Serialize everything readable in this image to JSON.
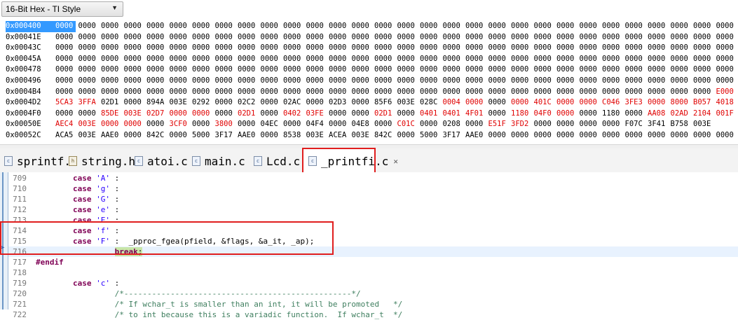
{
  "memory_view": {
    "format_select": "16-Bit Hex - TI Style",
    "rows": [
      {
        "addr": "0x000400",
        "words": [
          "0000",
          "0000",
          "0000",
          "0000",
          "0000",
          "0000",
          "0000",
          "0000",
          "0000",
          "0000",
          "0000",
          "0000",
          "0000",
          "0000",
          "0000",
          "0000",
          "0000",
          "0000",
          "0000",
          "0000",
          "0000",
          "0000",
          "0000",
          "0000",
          "0000",
          "0000",
          "0000",
          "0000",
          "0000",
          "0000"
        ]
      },
      {
        "addr": "0x00041E",
        "words": [
          "0000",
          "0000",
          "0000",
          "0000",
          "0000",
          "0000",
          "0000",
          "0000",
          "0000",
          "0000",
          "0000",
          "0000",
          "0000",
          "0000",
          "0000",
          "0000",
          "0000",
          "0000",
          "0000",
          "0000",
          "0000",
          "0000",
          "0000",
          "0000",
          "0000",
          "0000",
          "0000",
          "0000",
          "0000",
          "0000"
        ]
      },
      {
        "addr": "0x00043C",
        "words": [
          "0000",
          "0000",
          "0000",
          "0000",
          "0000",
          "0000",
          "0000",
          "0000",
          "0000",
          "0000",
          "0000",
          "0000",
          "0000",
          "0000",
          "0000",
          "0000",
          "0000",
          "0000",
          "0000",
          "0000",
          "0000",
          "0000",
          "0000",
          "0000",
          "0000",
          "0000",
          "0000",
          "0000",
          "0000",
          "0000"
        ]
      },
      {
        "addr": "0x00045A",
        "words": [
          "0000",
          "0000",
          "0000",
          "0000",
          "0000",
          "0000",
          "0000",
          "0000",
          "0000",
          "0000",
          "0000",
          "0000",
          "0000",
          "0000",
          "0000",
          "0000",
          "0000",
          "0000",
          "0000",
          "0000",
          "0000",
          "0000",
          "0000",
          "0000",
          "0000",
          "0000",
          "0000",
          "0000",
          "0000",
          "0000"
        ]
      },
      {
        "addr": "0x000478",
        "words": [
          "0000",
          "0000",
          "0000",
          "0000",
          "0000",
          "0000",
          "0000",
          "0000",
          "0000",
          "0000",
          "0000",
          "0000",
          "0000",
          "0000",
          "0000",
          "0000",
          "0000",
          "0000",
          "0000",
          "0000",
          "0000",
          "0000",
          "0000",
          "0000",
          "0000",
          "0000",
          "0000",
          "0000",
          "0000",
          "0000"
        ]
      },
      {
        "addr": "0x000496",
        "words": [
          "0000",
          "0000",
          "0000",
          "0000",
          "0000",
          "0000",
          "0000",
          "0000",
          "0000",
          "0000",
          "0000",
          "0000",
          "0000",
          "0000",
          "0000",
          "0000",
          "0000",
          "0000",
          "0000",
          "0000",
          "0000",
          "0000",
          "0000",
          "0000",
          "0000",
          "0000",
          "0000",
          "0000",
          "0000",
          "0000"
        ]
      },
      {
        "addr": "0x0004B4",
        "words": [
          "0000",
          "0000",
          "0000",
          "0000",
          "0000",
          "0000",
          "0000",
          "0000",
          "0000",
          "0000",
          "0000",
          "0000",
          "0000",
          "0000",
          "0000",
          "0000",
          "0000",
          "0000",
          "0000",
          "0000",
          "0000",
          "0000",
          "0000",
          "0000",
          "0000",
          "0000",
          "0000",
          "0000",
          "0000",
          "E000"
        ],
        "changed": [
          29
        ]
      },
      {
        "addr": "0x0004D2",
        "words": [
          "5CA3",
          "3FFA",
          "02D1",
          "0000",
          "894A",
          "003E",
          "0292",
          "0000",
          "02C2",
          "0000",
          "02AC",
          "0000",
          "02D3",
          "0000",
          "85F6",
          "003E",
          "028C",
          "0004",
          "0000",
          "0000",
          "0000",
          "401C",
          "0000",
          "0000",
          "C046",
          "3FE3",
          "0000",
          "8000",
          "B057",
          "4018"
        ],
        "changed": [
          0,
          1,
          17,
          18,
          20,
          21,
          22,
          23,
          24,
          25,
          26,
          27,
          28,
          29
        ]
      },
      {
        "addr": "0x0004F0",
        "words": [
          "0000",
          "0000",
          "85DE",
          "003E",
          "02D7",
          "0000",
          "0000",
          "0000",
          "02D1",
          "0000",
          "0402",
          "03FE",
          "0000",
          "0000",
          "02D1",
          "0000",
          "0401",
          "0401",
          "4F01",
          "0000",
          "1180",
          "04F0",
          "0000",
          "0000",
          "1180",
          "0000",
          "AA08",
          "02AD",
          "2104",
          "001F"
        ],
        "changed": [
          2,
          3,
          4,
          5,
          6,
          8,
          10,
          11,
          14,
          16,
          17,
          18,
          20,
          21,
          22,
          26,
          27,
          28,
          29
        ]
      },
      {
        "addr": "0x00050E",
        "words": [
          "AEC4",
          "003E",
          "0000",
          "0000",
          "0000",
          "3CF0",
          "0000",
          "3800",
          "0000",
          "04EC",
          "0000",
          "04F4",
          "0000",
          "04E8",
          "0000",
          "C01C",
          "0000",
          "0208",
          "0000",
          "E51F",
          "3FD2",
          "0000",
          "0000",
          "0000",
          "0000",
          "F07C",
          "3F41",
          "B758",
          "003E"
        ],
        "changed": [
          0,
          1,
          2,
          3,
          5,
          7,
          15,
          19,
          20
        ]
      },
      {
        "addr": "0x00052C",
        "words": [
          "ACA5",
          "003E",
          "AAE0",
          "0000",
          "842C",
          "0000",
          "5000",
          "3F17",
          "AAE0",
          "0000",
          "8538",
          "003E",
          "ACEA",
          "003E",
          "842C",
          "0000",
          "5000",
          "3F17",
          "AAE0",
          "0000",
          "0000",
          "0000",
          "0000",
          "0000",
          "0000",
          "0000",
          "0000",
          "0000",
          "0000",
          "0000"
        ]
      }
    ]
  },
  "tabs": [
    {
      "label": "sprintf.c",
      "icon": "c"
    },
    {
      "label": "string.h",
      "icon": "h"
    },
    {
      "label": "atoi.c",
      "icon": "c"
    },
    {
      "label": "main.c",
      "icon": "c"
    },
    {
      "label": "Lcd.c",
      "icon": "c"
    },
    {
      "label": "_printfi.c",
      "icon": "c",
      "active": true,
      "close": "✕"
    }
  ],
  "code_lines": [
    {
      "num": "709",
      "parts": [
        {
          "t": "        "
        },
        {
          "t": "case",
          "c": "kw"
        },
        {
          "t": " "
        },
        {
          "t": "'A'",
          "c": "str"
        },
        {
          "t": " :"
        }
      ]
    },
    {
      "num": "710",
      "parts": [
        {
          "t": "        "
        },
        {
          "t": "case",
          "c": "kw"
        },
        {
          "t": " "
        },
        {
          "t": "'g'",
          "c": "str"
        },
        {
          "t": " :"
        }
      ]
    },
    {
      "num": "711",
      "parts": [
        {
          "t": "        "
        },
        {
          "t": "case",
          "c": "kw"
        },
        {
          "t": " "
        },
        {
          "t": "'G'",
          "c": "str"
        },
        {
          "t": " :"
        }
      ]
    },
    {
      "num": "712",
      "parts": [
        {
          "t": "        "
        },
        {
          "t": "case",
          "c": "kw"
        },
        {
          "t": " "
        },
        {
          "t": "'e'",
          "c": "str"
        },
        {
          "t": " :"
        }
      ]
    },
    {
      "num": "713",
      "parts": [
        {
          "t": "        "
        },
        {
          "t": "case",
          "c": "kw"
        },
        {
          "t": " "
        },
        {
          "t": "'E'",
          "c": "str"
        },
        {
          "t": " :"
        }
      ]
    },
    {
      "num": "714",
      "parts": [
        {
          "t": "        "
        },
        {
          "t": "case",
          "c": "kw"
        },
        {
          "t": " "
        },
        {
          "t": "'f'",
          "c": "str"
        },
        {
          "t": " :"
        }
      ]
    },
    {
      "num": "715",
      "parts": [
        {
          "t": "        "
        },
        {
          "t": "case",
          "c": "kw"
        },
        {
          "t": " "
        },
        {
          "t": "'F'",
          "c": "str"
        },
        {
          "t": " :  _pproc_fgea(pfield, &flags, &a_it, _ap);"
        }
      ]
    },
    {
      "num": "716",
      "current": true,
      "parts": [
        {
          "t": "                 "
        },
        {
          "t": "break",
          "c": "kw hl"
        },
        {
          "t": ";",
          "c": "hl"
        }
      ]
    },
    {
      "num": "717",
      "parts": [
        {
          "t": "#endif",
          "c": "pp"
        }
      ]
    },
    {
      "num": "718",
      "parts": [
        {
          "t": ""
        }
      ]
    },
    {
      "num": "719",
      "parts": [
        {
          "t": "        "
        },
        {
          "t": "case",
          "c": "kw"
        },
        {
          "t": " "
        },
        {
          "t": "'c'",
          "c": "str"
        },
        {
          "t": " :"
        }
      ]
    },
    {
      "num": "720",
      "parts": [
        {
          "t": "                 "
        },
        {
          "t": "/*-------------------------------------------------*/",
          "c": "cmt"
        }
      ]
    },
    {
      "num": "721",
      "parts": [
        {
          "t": "                 "
        },
        {
          "t": "/* If wchar_t is smaller than an int, it will be promoted   */",
          "c": "cmt"
        }
      ]
    },
    {
      "num": "722",
      "parts": [
        {
          "t": "                 "
        },
        {
          "t": "/* to int because this is a variadic function.  If wchar_t  */",
          "c": "cmt"
        }
      ]
    }
  ],
  "colors": {
    "selection": "#3399ff",
    "changed": "#e00000",
    "highlight_box": "#e01e1e",
    "current_line": "#e8f2fe"
  }
}
